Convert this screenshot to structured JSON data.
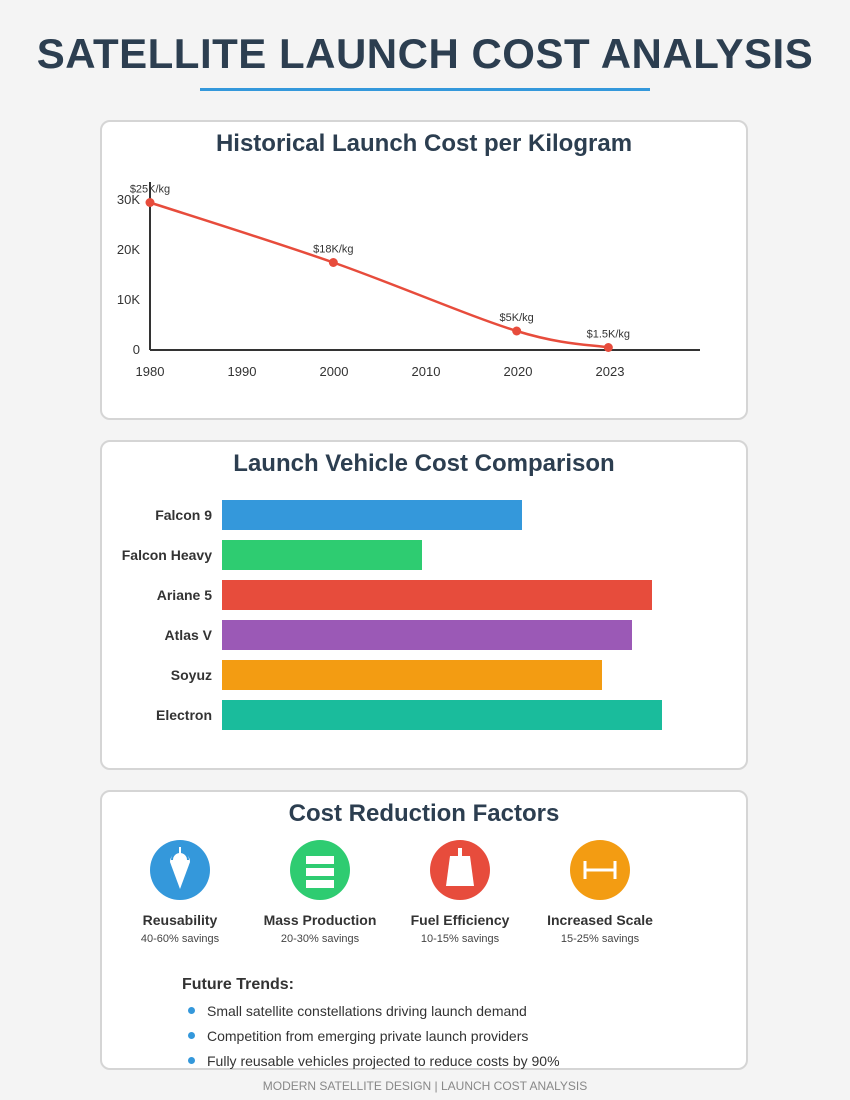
{
  "page": {
    "title": "SATELLITE LAUNCH COST ANALYSIS",
    "footer": "MODERN SATELLITE DESIGN | LAUNCH COST ANALYSIS"
  },
  "chart_data": [
    {
      "type": "line",
      "title": "Historical Launch Cost per Kilogram",
      "x_ticks": [
        "1980",
        "1990",
        "2000",
        "2010",
        "2020",
        "2023"
      ],
      "y_ticks": [
        "0",
        "10K",
        "20K",
        "30K"
      ],
      "ylim": [
        0,
        30000
      ],
      "xlim": [
        1980,
        2040
      ],
      "grid": false,
      "points": [
        {
          "x": 1980,
          "y": 29500,
          "label": "$25K/kg"
        },
        {
          "x": 2000,
          "y": 17500,
          "label": "$18K/kg"
        },
        {
          "x": 2020,
          "y": 3800,
          "label": "$5K/kg"
        },
        {
          "x": 2030,
          "y": 500,
          "label": "$1.5K/kg"
        }
      ],
      "color": "#e74c3c"
    },
    {
      "type": "bar",
      "orientation": "horizontal",
      "title": "Launch Vehicle Cost Comparison",
      "categories": [
        "Falcon 9",
        "Falcon Heavy",
        "Ariane 5",
        "Atlas V",
        "Soyuz",
        "Electron"
      ],
      "values": [
        300,
        200,
        430,
        410,
        380,
        440
      ],
      "colors": [
        "#3498db",
        "#2ecc71",
        "#e74c3c",
        "#9b59b6",
        "#f39c12",
        "#1abc9c"
      ]
    }
  ],
  "factors": {
    "title": "Cost Reduction Factors",
    "items": [
      {
        "name": "Reusability",
        "savings": "40-60% savings",
        "color": "#3498db",
        "icon": "rocket-icon"
      },
      {
        "name": "Mass Production",
        "savings": "20-30% savings",
        "color": "#2ecc71",
        "icon": "stack-icon"
      },
      {
        "name": "Fuel Efficiency",
        "savings": "10-15% savings",
        "color": "#e74c3c",
        "icon": "fuel-tank-icon"
      },
      {
        "name": "Increased Scale",
        "savings": "15-25% savings",
        "color": "#f39c12",
        "icon": "scale-width-icon"
      }
    ],
    "trends_heading": "Future Trends:",
    "trends": [
      "Small satellite constellations driving launch demand",
      "Competition from emerging private launch providers",
      "Fully reusable vehicles projected to reduce costs by 90%"
    ]
  }
}
